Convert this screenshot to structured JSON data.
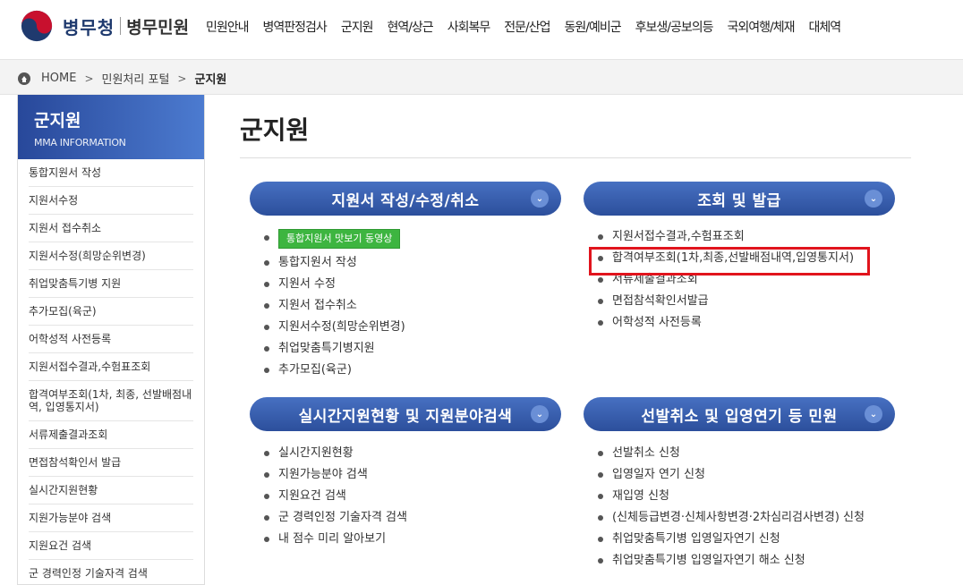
{
  "header": {
    "logo_text": "병무청",
    "logo_sub": "병무민원",
    "nav": [
      "민원안내",
      "병역판정검사",
      "군지원",
      "현역/상근",
      "사회복무",
      "전문/산업",
      "동원/예비군",
      "후보생/공보의등",
      "국외여행/체재",
      "대체역"
    ]
  },
  "breadcrumb": {
    "home": "HOME",
    "sep": ">",
    "level1": "민원처리 포털",
    "current": "군지원"
  },
  "sidebar": {
    "title": "군지원",
    "subtitle": "MMA INFORMATION",
    "items": [
      "통합지원서 작성",
      "지원서수정",
      "지원서 접수취소",
      "지원서수정(희망순위변경)",
      "취업맞춤특기병 지원",
      "추가모집(육군)",
      "어학성적 사전등록",
      "지원서접수결과,수험표조회",
      "합격여부조회(1차, 최종, 선발배점내역, 입영통지서)",
      "서류제출결과조회",
      "면접참석확인서 발급",
      "실시간지원현황",
      "지원가능분야 검색",
      "지원요건 검색",
      "군 경력인정 기술자격 검색"
    ]
  },
  "main": {
    "title": "군지원",
    "sections": [
      {
        "label": "지원서 작성/수정/취소",
        "video_button": "통합지원서 맛보기 동영상",
        "items": [
          "통합지원서 작성",
          "지원서 수정",
          "지원서 접수취소",
          "지원서수정(희망순위변경)",
          "취업맞춤특기병지원",
          "추가모집(육군)"
        ]
      },
      {
        "label": "조회 및 발급",
        "items": [
          "지원서접수결과,수험표조회",
          "합격여부조회(1차,최종,선발배점내역,입영통지서)",
          "서류제출결과조회",
          "면접참석확인서발급",
          "어학성적 사전등록"
        ]
      },
      {
        "label": "실시간지원현황 및 지원분야검색",
        "items": [
          "실시간지원현황",
          "지원가능분야 검색",
          "지원요건 검색",
          "군 경력인정 기술자격 검색",
          "내 점수 미리 알아보기"
        ]
      },
      {
        "label": "선발취소 및 입영연기 등 민원",
        "items": [
          "선발취소 신청",
          "입영일자 연기 신청",
          "재입영 신청",
          "(신체등급변경·신체사항변경·2차심리검사변경) 신청",
          "취업맞춤특기병 입영일자연기 신청",
          "취업맞춤특기병 입영일자연기 해소 신청"
        ]
      }
    ]
  },
  "colors": {
    "pill": "#3a60b2",
    "highlight": "#e1141d",
    "video_button": "#3db540"
  }
}
